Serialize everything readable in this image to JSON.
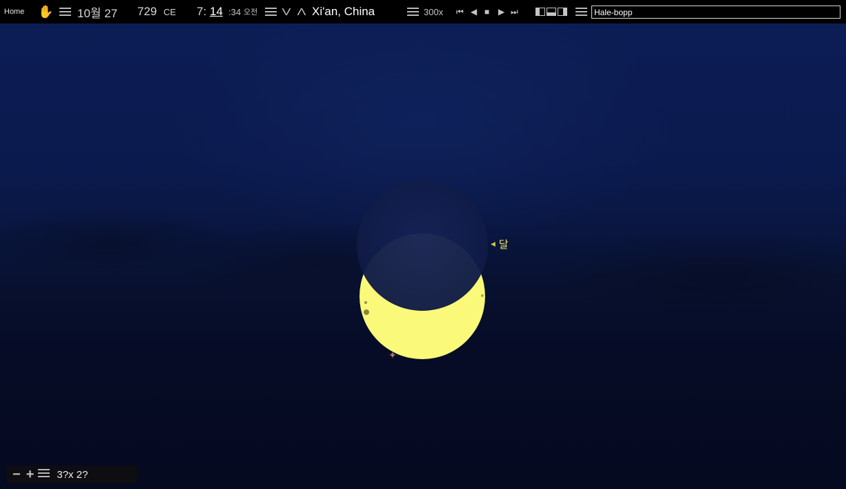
{
  "toolbar": {
    "home_label": "Home",
    "date": "10월 27",
    "year": "729",
    "era": "CE",
    "time_hour": "7:",
    "time_minute": "14",
    "time_second": ":34",
    "ampm": "오전",
    "location": "Xi'an, China",
    "speed": "300x",
    "search_value": "Hale-bopp"
  },
  "sky": {
    "moon_label": "달"
  },
  "bottom": {
    "fov": "3?x 2?"
  },
  "colors": {
    "sun": "#fbf97a",
    "moon_disk": "#111c45",
    "sky_top": "#0c1d55",
    "sky_bottom": "#050a20",
    "label": "#f2ea6a"
  }
}
